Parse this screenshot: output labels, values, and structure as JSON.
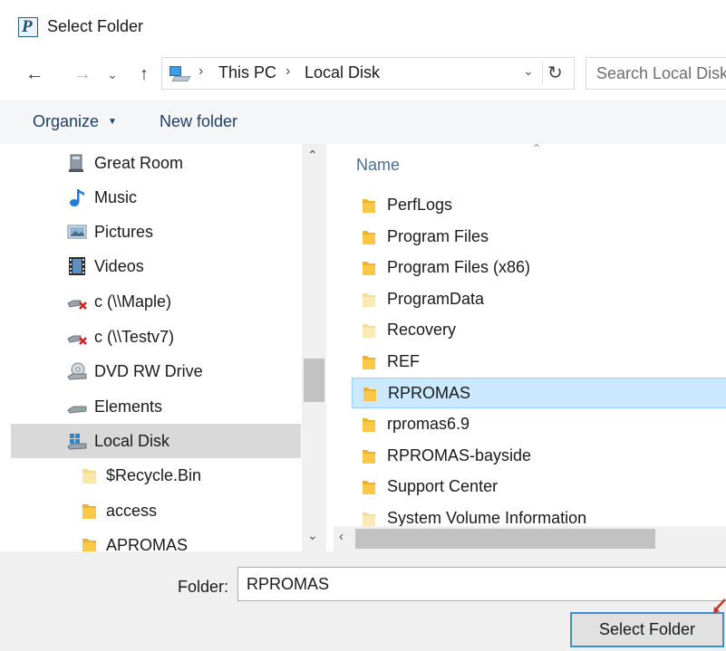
{
  "window": {
    "title": "Select Folder"
  },
  "address": {
    "breadcrumbs": [
      "This PC",
      "Local Disk"
    ],
    "search_placeholder": "Search Local Disk (C:)"
  },
  "toolbar": {
    "organize_label": "Organize",
    "new_folder_label": "New folder"
  },
  "nav_pane": {
    "items": [
      {
        "label": "Great Room",
        "icon": "network-folder-icon"
      },
      {
        "label": "Music",
        "icon": "music-note-icon"
      },
      {
        "label": "Pictures",
        "icon": "pictures-icon"
      },
      {
        "label": "Videos",
        "icon": "film-strip-icon"
      },
      {
        "label": "c (\\\\Maple)",
        "icon": "disconnected-drive-icon"
      },
      {
        "label": "c (\\\\Testv7)",
        "icon": "disconnected-drive-icon"
      },
      {
        "label": "DVD RW Drive",
        "icon": "dvd-drive-icon"
      },
      {
        "label": "Elements",
        "icon": "drive-icon"
      },
      {
        "label": "Local Disk",
        "icon": "windows-drive-icon",
        "selected": true
      },
      {
        "label": "$Recycle.Bin",
        "icon": "folder-icon"
      },
      {
        "label": "access",
        "icon": "folder-icon"
      },
      {
        "label": "APROMAS",
        "icon": "folder-icon"
      }
    ]
  },
  "content": {
    "column_header": "Name",
    "files": [
      {
        "name": "PerfLogs",
        "faded": false
      },
      {
        "name": "Program Files",
        "faded": false
      },
      {
        "name": "Program Files (x86)",
        "faded": false
      },
      {
        "name": "ProgramData",
        "faded": true
      },
      {
        "name": "Recovery",
        "faded": true
      },
      {
        "name": "REF",
        "faded": false
      },
      {
        "name": "RPROMAS",
        "faded": false,
        "selected": true
      },
      {
        "name": "rpromas6.9",
        "faded": false
      },
      {
        "name": "RPROMAS-bayside",
        "faded": false
      },
      {
        "name": "Support Center",
        "faded": false
      },
      {
        "name": "System Volume Information",
        "faded": true
      }
    ]
  },
  "footer": {
    "folder_label": "Folder:",
    "folder_value": "RPROMAS",
    "select_button_label": "Select Folder"
  },
  "colors": {
    "accent": "#3c8ed6",
    "selection": "#cce8ff",
    "folder": "#f8c846"
  }
}
